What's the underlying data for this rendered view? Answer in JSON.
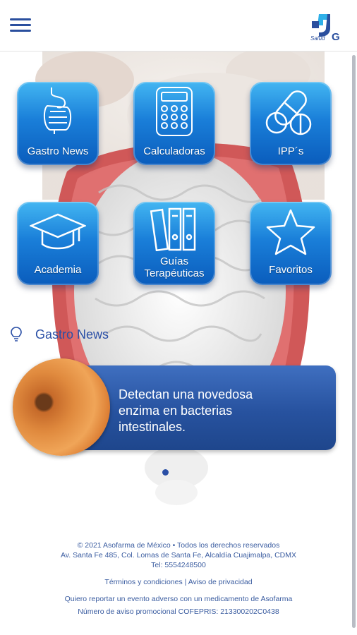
{
  "header": {
    "menu_icon": "hamburger-icon",
    "logo_text": "Salud G"
  },
  "tiles": [
    {
      "label": "Gastro News",
      "icon": "intestine-icon"
    },
    {
      "label": "Calculadoras",
      "icon": "calculator-icon"
    },
    {
      "label": "IPP´s",
      "icon": "pills-icon"
    },
    {
      "label": "Academia",
      "icon": "graduation-cap-icon"
    },
    {
      "label": "Guías Terapéuticas",
      "icon": "binders-icon"
    },
    {
      "label": "Favoritos",
      "icon": "star-icon"
    }
  ],
  "news": {
    "section_title": "Gastro News",
    "section_icon": "lightbulb-icon",
    "cards": [
      {
        "title": "Detectan una novedosa enzima en bacterias intestinales."
      }
    ],
    "active_slide": 1,
    "slide_count": 1
  },
  "footer": {
    "line1": "© 2021 Asofarma de México • Todos los derechos reservados",
    "line2": "Av. Santa Fe 485, Col. Lomas de Santa Fe, Alcaldía Cuajimalpa, CDMX",
    "line3": "Tel: 5554248500",
    "terms": "Términos y condiciones",
    "separator": " | ",
    "privacy": "Aviso de privacidad",
    "report": "Quiero reportar un evento adverso con un medicamento de Asofarma",
    "cofepris": "Número de aviso promocional COFEPRIS: 213300202C0438"
  },
  "colors": {
    "brand_blue": "#2a4f9e",
    "tile_blue": "#1a7fd9",
    "card_blue": "#27529f"
  }
}
